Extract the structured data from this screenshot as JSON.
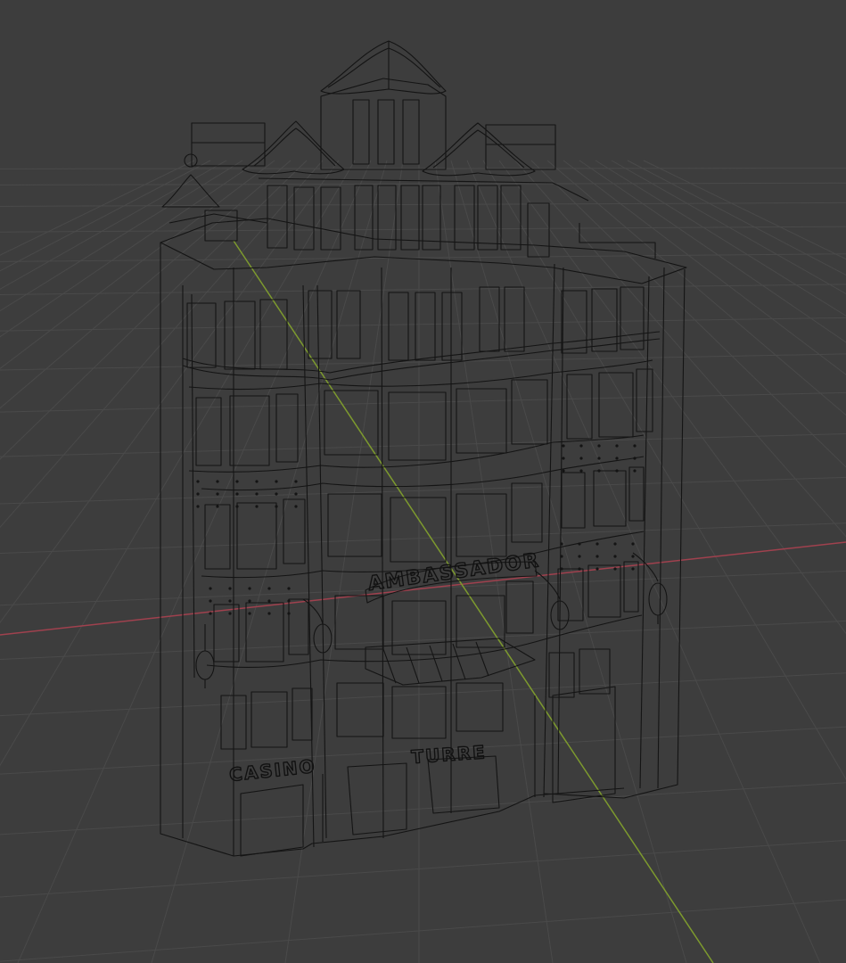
{
  "viewport": {
    "kind": "3D viewport",
    "shading_mode": "wireframe",
    "background_color": "#3d3d3d",
    "grid_color": "#4a4a4a",
    "wire_color": "#141414",
    "x_axis_color": "#a0414e",
    "y_axis_color": "#7d9a2e"
  },
  "model": {
    "subject": "ornate corner building with turrets",
    "signs": {
      "roof_sign": "AMBASSADOR",
      "left_sign": "CASINO",
      "front_sign": "TURRE"
    }
  }
}
